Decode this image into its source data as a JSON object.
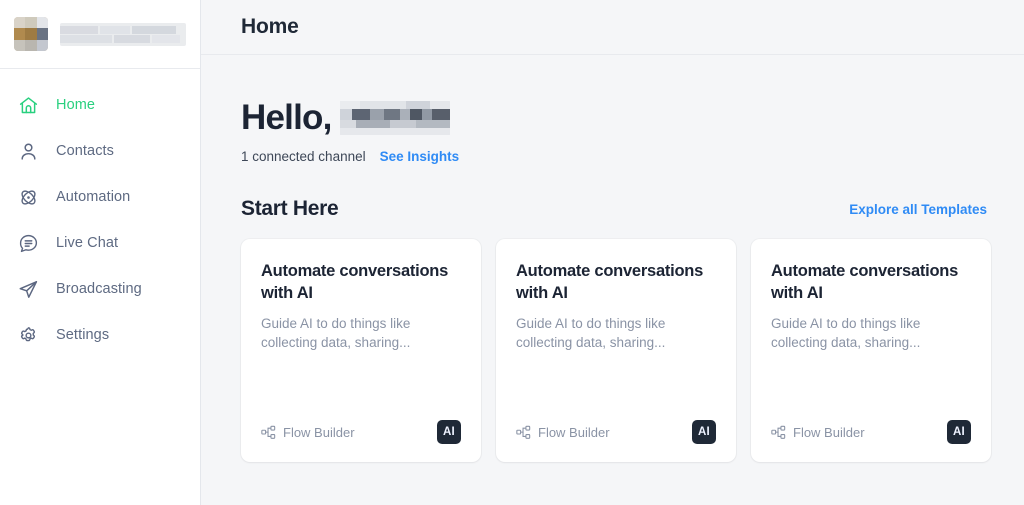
{
  "sidebar": {
    "workspace": {
      "avatar_icon": "workspace-avatar-redacted",
      "name_redacted": true
    },
    "items": [
      {
        "label": "Home",
        "icon": "home-icon",
        "active": true
      },
      {
        "label": "Contacts",
        "icon": "user-icon",
        "active": false
      },
      {
        "label": "Automation",
        "icon": "atom-icon",
        "active": false
      },
      {
        "label": "Live Chat",
        "icon": "chat-bubble-icon",
        "active": false
      },
      {
        "label": "Broadcasting",
        "icon": "paper-plane-icon",
        "active": false
      },
      {
        "label": "Settings",
        "icon": "gear-icon",
        "active": false
      }
    ]
  },
  "header": {
    "title": "Home"
  },
  "hero": {
    "greeting": "Hello,",
    "name_redacted": true,
    "connected_channels": "1 connected channel",
    "insights_link": "See Insights"
  },
  "start_here": {
    "title": "Start Here",
    "explore_link": "Explore all Templates",
    "cards": [
      {
        "title": "Automate conversations with AI",
        "description": "Guide AI to do things like collecting data, sharing...",
        "meta_icon": "flow-builder-icon",
        "meta_label": "Flow Builder",
        "badge": "AI"
      },
      {
        "title": "Automate conversations with AI",
        "description": "Guide AI to do things like collecting data, sharing...",
        "meta_icon": "flow-builder-icon",
        "meta_label": "Flow Builder",
        "badge": "AI"
      },
      {
        "title": "Automate conversations with AI",
        "description": "Guide AI to do things like collecting data, sharing...",
        "meta_icon": "flow-builder-icon",
        "meta_label": "Flow Builder",
        "badge": "AI"
      }
    ]
  },
  "colors": {
    "accent_green": "#29d07f",
    "link_blue": "#2f8bf5",
    "text_dark": "#1c2434",
    "text_muted": "#8a93a5",
    "nav_text": "#5e6a82",
    "page_bg": "#f5f6f8",
    "card_bg": "#ffffff",
    "badge_bg": "#1f2937"
  }
}
